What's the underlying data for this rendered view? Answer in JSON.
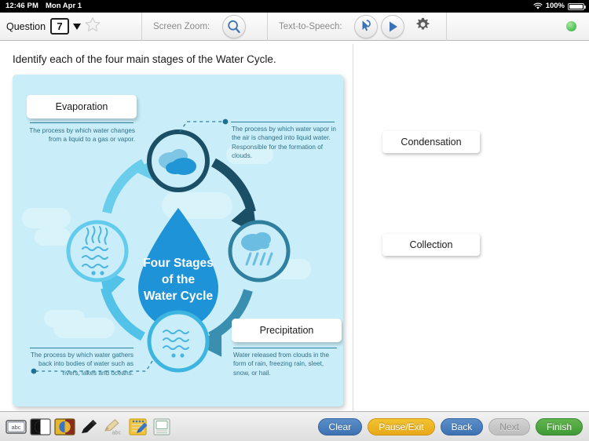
{
  "status_bar": {
    "time": "12:46 PM",
    "date": "Mon Apr 1",
    "battery_percent": "100%",
    "wifi_icon": "wifi-icon",
    "battery_icon": "battery-icon"
  },
  "toolbar": {
    "question_label": "Question",
    "question_number": "7",
    "dropdown_icon": "chevron-down-icon",
    "flag_icon": "star-outline-icon",
    "screen_zoom_label": "Screen Zoom:",
    "zoom_icon": "magnifier-icon",
    "tts_label": "Text-to-Speech:",
    "tts_pointer_icon": "speech-pointer-icon",
    "tts_play_icon": "play-icon",
    "settings_icon": "gear-icon",
    "status_indicator": "green-status-dot"
  },
  "question": {
    "prompt": "Identify each of the four main stages of the Water Cycle."
  },
  "figure": {
    "center_title_lines": [
      "Four Stages",
      "of the",
      "Water Cycle"
    ],
    "stages": [
      {
        "id": "evaporation",
        "label": "Evaporation",
        "label_filled": true,
        "description": "The process by which water changes from a liquid to a gas or vapor.",
        "icon": "water-waves-evaporating-icon"
      },
      {
        "id": "condensation",
        "label": "",
        "label_filled": false,
        "description": "The process by which water vapor in the air is changed into liquid water. Responsible for the formation of clouds.",
        "icon": "clouds-icon"
      },
      {
        "id": "precipitation",
        "label": "Precipitation",
        "label_filled": true,
        "description": "Water released from clouds in the form of rain, freezing rain, sleet, snow, or hail.",
        "icon": "rain-cloud-icon"
      },
      {
        "id": "collection",
        "label": "",
        "label_filled": false,
        "description": "The process by which water gathers back into bodies of water such as rivers, lakes and oceans.",
        "icon": "water-waves-icon"
      }
    ],
    "colors": {
      "background": "#c9eefa",
      "drop": "#2196d6",
      "dark_ring": "#1b4f66",
      "light_ring": "#4ec0e8",
      "text": "#2f6f84"
    }
  },
  "answer_choices": [
    {
      "id": "choice-condensation",
      "label": "Condensation"
    },
    {
      "id": "choice-collection",
      "label": "Collection"
    }
  ],
  "bottom_bar": {
    "tools": [
      {
        "name": "abc-text-tool-icon",
        "title": "abc"
      },
      {
        "name": "contrast-tool-icon",
        "title": ""
      },
      {
        "name": "color-overlay-tool-icon",
        "title": ""
      },
      {
        "name": "pencil-tool-icon",
        "title": ""
      },
      {
        "name": "highlighter-abc-tool-icon",
        "title": "abc"
      },
      {
        "name": "notepad-tool-icon",
        "title": ""
      },
      {
        "name": "eraser-sheet-tool-icon",
        "title": ""
      }
    ],
    "buttons": [
      {
        "id": "clear-button",
        "label": "Clear",
        "style": "blue",
        "enabled": true
      },
      {
        "id": "pause-exit-button",
        "label": "Pause/Exit",
        "style": "amber",
        "enabled": true
      },
      {
        "id": "back-button",
        "label": "Back",
        "style": "blue",
        "enabled": true
      },
      {
        "id": "next-button",
        "label": "Next",
        "style": "grey",
        "enabled": false
      },
      {
        "id": "finish-button",
        "label": "Finish",
        "style": "green",
        "enabled": true
      }
    ]
  }
}
